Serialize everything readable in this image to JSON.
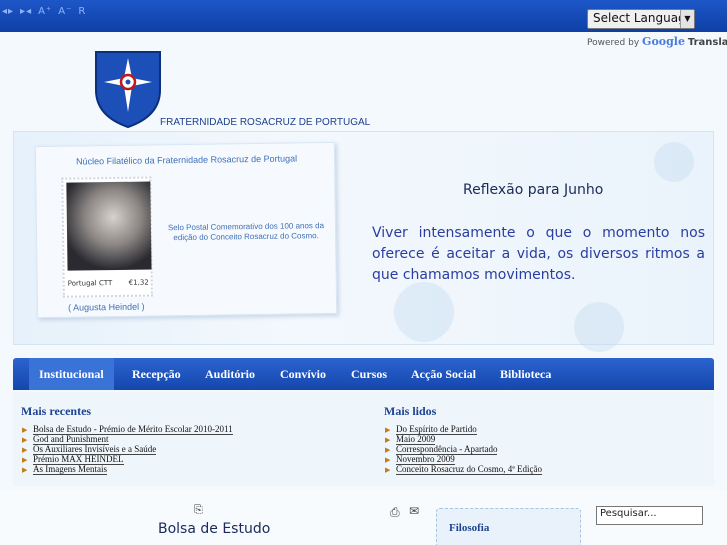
{
  "toolbar": {
    "tools": [
      "◂▸",
      "▸◂",
      "A⁺",
      "A⁻",
      "R"
    ]
  },
  "translate": {
    "select_label": "Select Language",
    "powered_by": "Powered by",
    "google": "Google",
    "translate": "Translate"
  },
  "header": {
    "org_name": "FRATERNIDADE ROSACRUZ DE PORTUGAL"
  },
  "banner": {
    "stamp_title": "Núcleo Filatélico da Fraternidade Rosacruz de Portugal",
    "stamp_description": "Selo Postal Comemorativo dos 100 anos da edição do Conceito Rosacruz do Cosmo.",
    "stamp_country": "Portugal CTT",
    "stamp_value": "€1,32",
    "stamp_caption": "( Augusta  Heindel )",
    "reflection_title": "Reflexão para Junho",
    "reflection_text": "Viver intensamente o que o momento nos oferece é aceitar a vida, os diversos ritmos a que chamamos movimentos."
  },
  "nav": {
    "items": [
      {
        "label": "Institucional",
        "active": true
      },
      {
        "label": "Recepção"
      },
      {
        "label": "Auditório"
      },
      {
        "label": "Convívio"
      },
      {
        "label": "Cursos"
      },
      {
        "label": "Acção Social"
      },
      {
        "label": "Biblioteca"
      }
    ]
  },
  "recent": {
    "title": "Mais recentes",
    "items": [
      "Bolsa de Estudo - Prémio de Mérito Escolar 2010-2011",
      "God and Punishment",
      "Os Auxiliares Invisíveis e a Saúde",
      "Prémio MAX HEINDEL",
      "As Imagens Mentais"
    ]
  },
  "most_read": {
    "title": "Mais lidos",
    "items": [
      "Do Espírito de Partido",
      "Maio 2009",
      "Correspondência - Apartado",
      "Novembro 2009",
      "Conceito Rosacruz do Cosmo, 4ª Edição"
    ]
  },
  "article": {
    "title": "Bolsa de Estudo"
  },
  "sidebar": {
    "title": "Filosofia"
  },
  "search": {
    "value": "Pesquisar..."
  },
  "colors": {
    "topbar": "#1547ad",
    "nav": "#1e55bd",
    "accent_text": "#2a3da0"
  }
}
